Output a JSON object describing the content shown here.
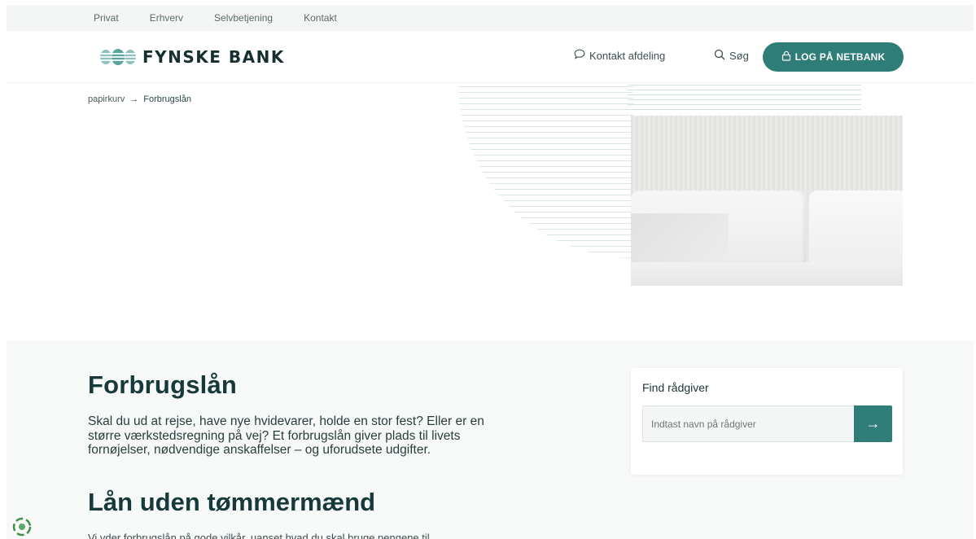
{
  "topnav": {
    "items": [
      "Privat",
      "Erhverv",
      "Selvbetjening",
      "Kontakt"
    ]
  },
  "header": {
    "logo_text": "FYNSKE BANK",
    "contact_label": "Kontakt afdeling",
    "search_label": "Søg",
    "login_label": "LOG PÅ NETBANK"
  },
  "breadcrumb": {
    "parent": "papirkurv",
    "separator": "→",
    "current": "Forbrugslån"
  },
  "main": {
    "title": "Forbrugslån",
    "lead": "Skal du ud at rejse, have nye hvidevarer, holde en stor fest? Eller er en større værkstedsregning på vej? Et forbrugslån giver plads til livets fornøjelser, nødvendige anskaffelser – og uforudsete udgifter.",
    "subtitle": "Lån uden tømmermænd",
    "body": "Vi yder forbrugslån på gode vilkår, uanset hvad du skal bruge pengene til"
  },
  "advisor": {
    "title": "Find rådgiver",
    "placeholder": "Indtast navn på rådgiver",
    "submit_symbol": "→"
  },
  "colors": {
    "brand": "#2f7d78",
    "heading": "#163a3a",
    "accent_light": "#cde4e2"
  },
  "icons": [
    "chat-bubble-icon",
    "search-icon",
    "lock-icon",
    "arrow-right-icon",
    "logo-mark-icon",
    "chat-widget-icon"
  ]
}
